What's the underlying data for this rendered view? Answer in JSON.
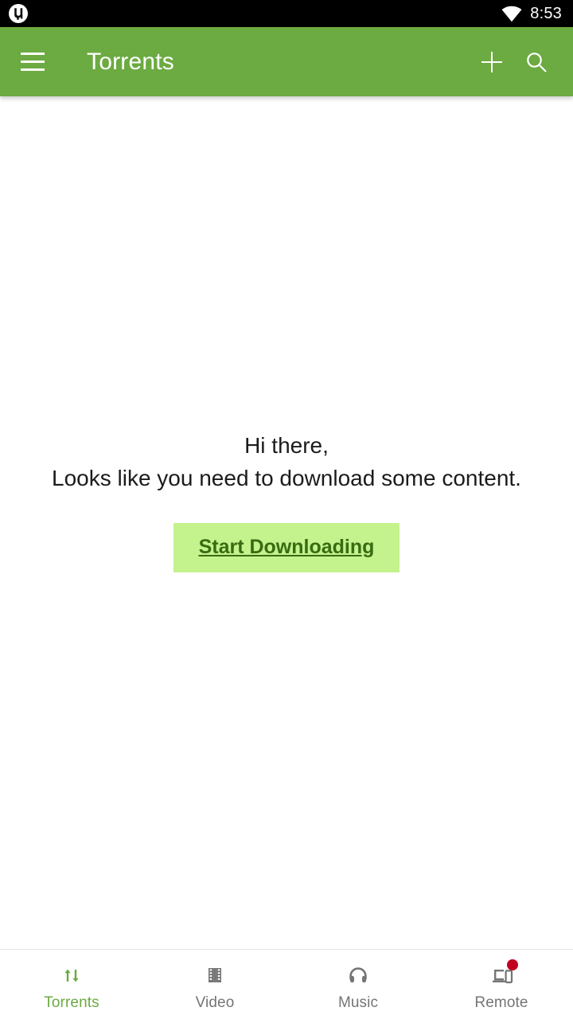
{
  "status_bar": {
    "app_icon": "utorrent-logo-icon",
    "wifi_icon": "wifi-icon",
    "time": "8:53",
    "background_color": "#000000",
    "text_color": "#ffffff"
  },
  "app_bar": {
    "menu_icon": "hamburger-menu-icon",
    "title": "Torrents",
    "add_icon": "plus-icon",
    "search_icon": "search-icon",
    "background_color": "#6caa42",
    "text_color": "#ffffff"
  },
  "empty_state": {
    "line1": "Hi there,",
    "line2": "Looks like you need to download some content.",
    "cta_label": "Start Downloading",
    "cta_background_color": "#c4f28c",
    "cta_text_color": "#386b12"
  },
  "bottom_nav": {
    "active_color": "#6caa42",
    "inactive_color": "#757575",
    "badge_color": "#c2001f",
    "items": [
      {
        "label": "Torrents",
        "icon": "transfer-arrows-icon",
        "active": true,
        "badge": false
      },
      {
        "label": "Video",
        "icon": "film-strip-icon",
        "active": false,
        "badge": false
      },
      {
        "label": "Music",
        "icon": "headphones-icon",
        "active": false,
        "badge": false
      },
      {
        "label": "Remote",
        "icon": "laptop-phone-icon",
        "active": false,
        "badge": true
      }
    ]
  }
}
